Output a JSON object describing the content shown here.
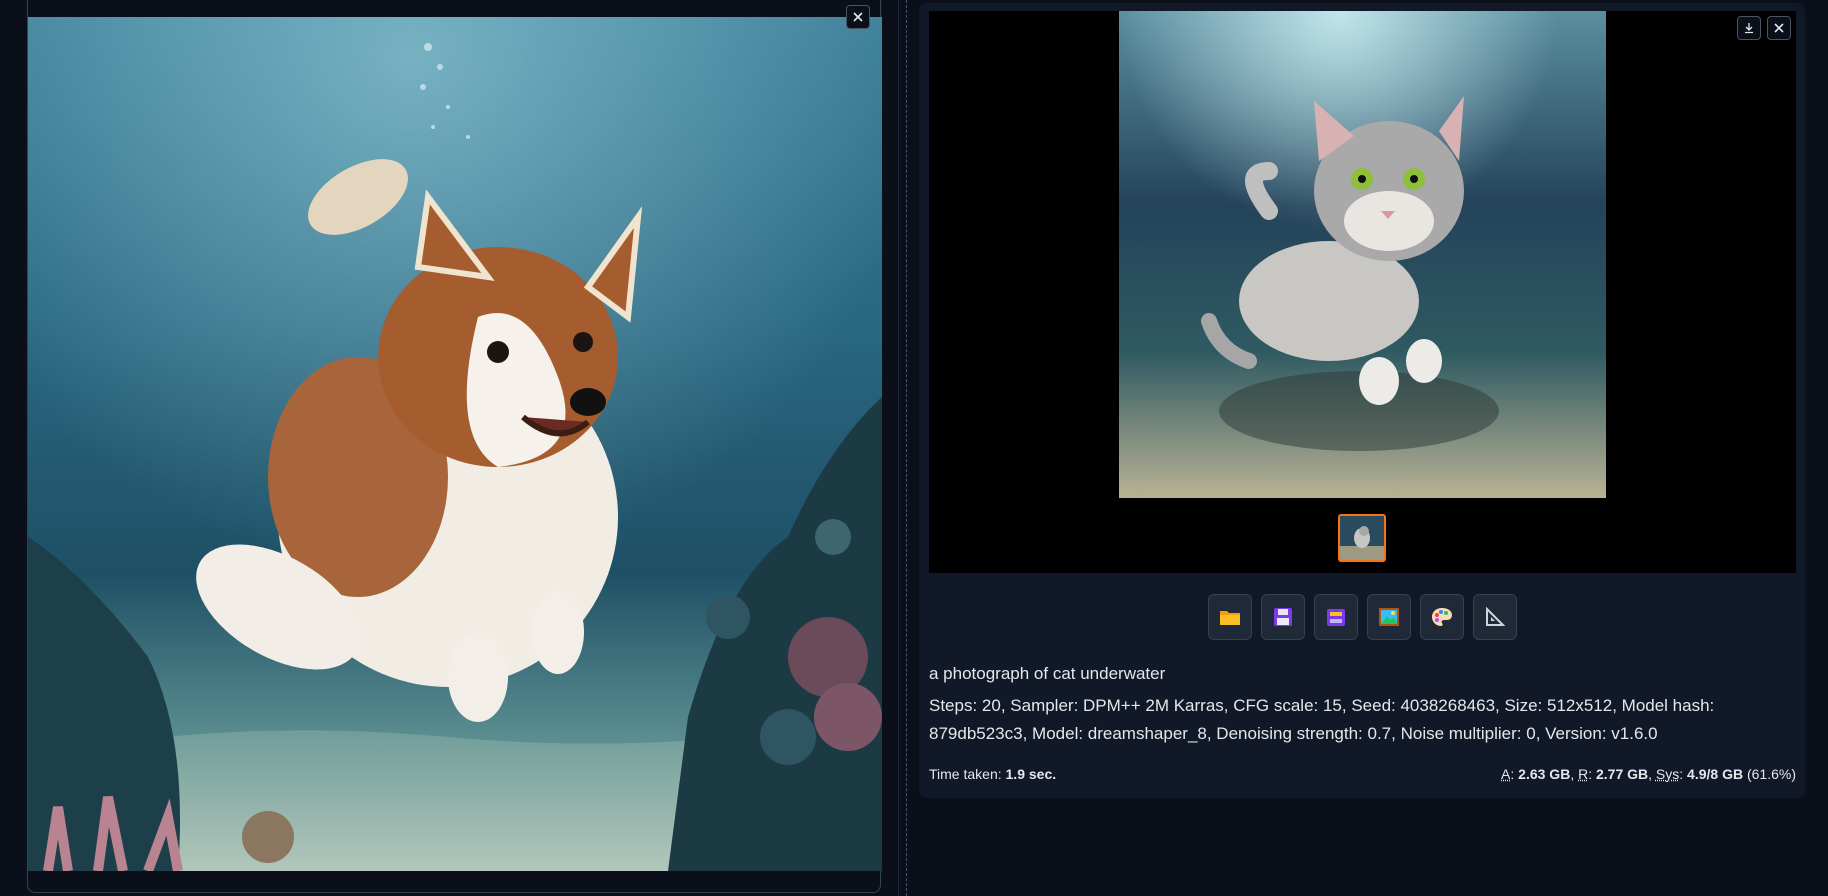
{
  "left_pane": {
    "image_alt": "photo of a dog underwater",
    "close_icon": "close-icon"
  },
  "right_pane": {
    "top_buttons": [
      {
        "name": "download-icon"
      },
      {
        "name": "close-icon"
      }
    ],
    "main_image_alt": "photograph of cat underwater",
    "thumbnail_selected": true,
    "toolbar": [
      {
        "name": "open-folder-button",
        "icon": "folder-icon",
        "color": "#f59e0b"
      },
      {
        "name": "save-button",
        "icon": "floppy-disk-icon",
        "color": "#a855f7"
      },
      {
        "name": "zip-button",
        "icon": "file-cabinet-icon",
        "color": "#a855f7"
      },
      {
        "name": "send-to-img2img-button",
        "icon": "framed-picture-icon",
        "color": "#38bdf8"
      },
      {
        "name": "send-to-inpaint-button",
        "icon": "palette-icon",
        "color": "#fbbf24"
      },
      {
        "name": "send-to-extras-button",
        "icon": "triangle-ruler-icon",
        "color": "#9ca3af"
      }
    ],
    "prompt": "a photograph of cat underwater",
    "params": "Steps: 20, Sampler: DPM++ 2M Karras, CFG scale: 15, Seed: 4038268463, Size: 512x512, Model hash: 879db523c3, Model: dreamshaper_8, Denoising strength: 0.7, Noise multiplier: 0, Version: v1.6.0",
    "time_label": "Time taken:",
    "time_value": "1.9 sec.",
    "mem": {
      "a_label": "A",
      "a_value": "2.63 GB",
      "r_label": "R",
      "r_value": "2.77 GB",
      "sys_label": "Sys",
      "sys_value": "4.9/8 GB",
      "sys_pct": "(61.6%)"
    }
  }
}
